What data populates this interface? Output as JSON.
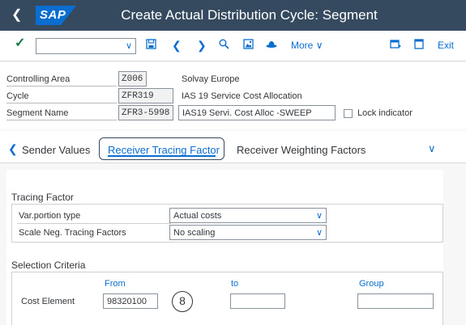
{
  "titlebar": {
    "back_icon": "chevron-left-icon",
    "logo_text": "SAP",
    "title": "Create Actual Distribution Cycle: Segment"
  },
  "toolbar": {
    "more_label": "More",
    "exit_label": "Exit",
    "command_value": ""
  },
  "header": {
    "controlling_area": {
      "label": "Controlling Area",
      "value": "Z006",
      "desc": "Solvay Europe"
    },
    "cycle": {
      "label": "Cycle",
      "value": "ZFR319",
      "desc": "IAS 19 Service Cost Allocation"
    },
    "segment": {
      "label": "Segment Name",
      "value": "ZFR3-5998",
      "desc": "IAS19 Servi. Cost Alloc -SWEEP"
    },
    "lock_label": "Lock indicator"
  },
  "tabs": [
    {
      "label": "Sender Values"
    },
    {
      "label": "Receiver Tracing Factor"
    },
    {
      "label": "Receiver Weighting Factors"
    }
  ],
  "tracing": {
    "title": "Tracing Factor",
    "var_portion": {
      "label": "Var.portion type",
      "value": "Actual costs"
    },
    "scale_neg": {
      "label": "Scale Neg. Tracing Factors",
      "value": "No scaling"
    }
  },
  "selection": {
    "title": "Selection Criteria",
    "col_from": "From",
    "col_to": "to",
    "col_group": "Group",
    "row_label": "Cost Element",
    "from_value": "98320100",
    "to_value": "",
    "group_value": ""
  },
  "annotation": "8",
  "colors": {
    "shell": "#354a5f",
    "accent": "#0a6ed1",
    "ok": "#107e3e"
  }
}
